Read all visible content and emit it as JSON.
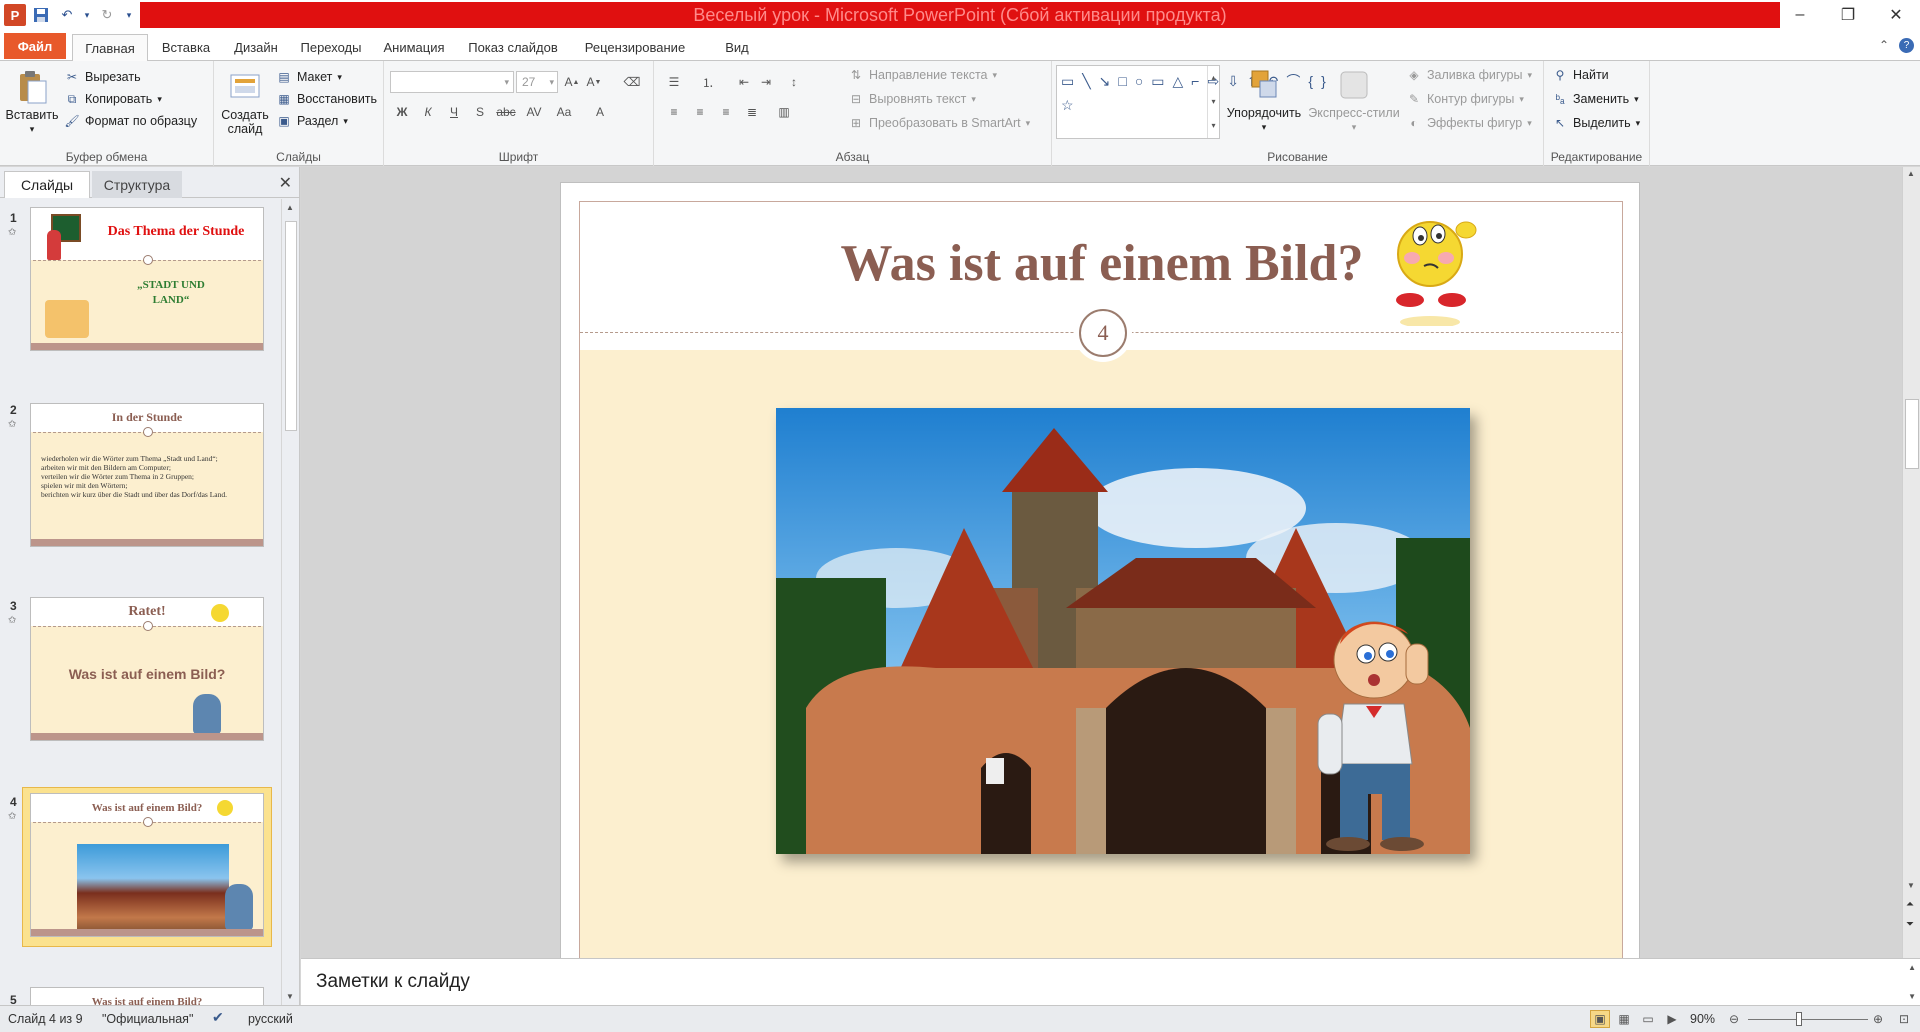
{
  "window": {
    "title": "Веселый урок  -  Microsoft PowerPoint (Сбой активации продукта)"
  },
  "tabs": [
    "Файл",
    "Главная",
    "Вставка",
    "Дизайн",
    "Переходы",
    "Анимация",
    "Показ слайдов",
    "Рецензирование",
    "Вид"
  ],
  "ribbon": {
    "clipboard": {
      "paste": "Вставить",
      "cut": "Вырезать",
      "copy": "Копировать",
      "format_painter": "Формат по образцу",
      "label": "Буфер обмена"
    },
    "slides": {
      "new_slide": "Создать слайд",
      "layout": "Макет",
      "reset": "Восстановить",
      "section": "Раздел",
      "label": "Слайды"
    },
    "font": {
      "font_size": "27",
      "label": "Шрифт"
    },
    "paragraph": {
      "text_direction": "Направление текста",
      "align_text": "Выровнять текст",
      "smartart": "Преобразовать в SmartArt",
      "label": "Абзац"
    },
    "drawing": {
      "arrange": "Упорядочить",
      "quick_styles": "Экспресс-стили",
      "shape_fill": "Заливка фигуры",
      "shape_outline": "Контур фигуры",
      "shape_effects": "Эффекты фигур",
      "label": "Рисование"
    },
    "editing": {
      "find": "Найти",
      "replace": "Заменить",
      "select": "Выделить",
      "label": "Редактирование"
    }
  },
  "left_panel": {
    "tab_slides": "Слайды",
    "tab_outline": "Структура",
    "thumbnails": [
      {
        "num": "1",
        "title": "Das Thema der Stunde",
        "body": "„STADT UND LAND“"
      },
      {
        "num": "2",
        "title": "In der Stunde",
        "bullets": [
          "wiederholen wir die Wörter zum Thema „Stadt und Land“;",
          "arbeiten wir mit den Bildern am Computer;",
          "verteilen wir die Wörter zum Thema in 2 Gruppen;",
          "spielen wir mit den Wörtern;",
          "berichten wir kurz über die Stadt und über das Dorf/das Land."
        ]
      },
      {
        "num": "3",
        "title": "Ratet!",
        "body": "Was  ist auf einem Bild?"
      },
      {
        "num": "4",
        "title": "Was ist auf einem Bild?"
      },
      {
        "num": "5",
        "title": "Was ist auf einem Bild?"
      }
    ]
  },
  "slide": {
    "title": "Was ist auf einem Bild?",
    "number": "4"
  },
  "notes": {
    "placeholder": "Заметки к слайду"
  },
  "status": {
    "slide_info": "Слайд 4 из 9",
    "theme": "\"Официальная\"",
    "language": "русский",
    "zoom": "90%"
  },
  "colors": {
    "title_band": "#e01010",
    "file_tab": "#e8592b",
    "slide_title": "#8b5e52",
    "slide_bg": "#fcefcf",
    "slide_footer": "#bc958b"
  }
}
